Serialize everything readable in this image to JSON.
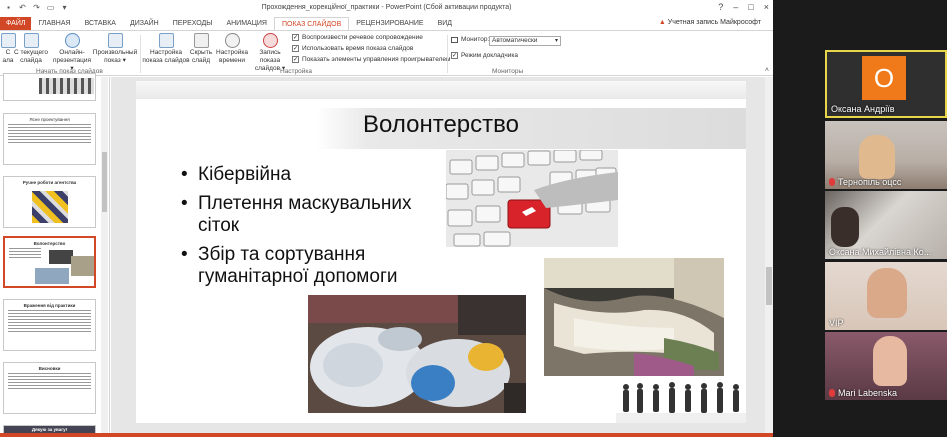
{
  "window": {
    "title": "Прохождення_корекційної_практики - PowerPoint (Сбой активации продукта)",
    "account": "Учетная запись Майкрософт",
    "controls": [
      "?",
      "–",
      "□",
      "×"
    ]
  },
  "tabs": [
    "ФАЙЛ",
    "ГЛАВНАЯ",
    "ВСТАВКА",
    "ДИЗАЙН",
    "ПЕРЕХОДЫ",
    "АНИМАЦИЯ",
    "ПОКАЗ СЛАЙДОВ",
    "РЕЦЕНЗИРОВАНИЕ",
    "ВИД"
  ],
  "active_tab": "ПОКАЗ СЛАЙДОВ",
  "ribbon": {
    "start_group": {
      "buttons": [
        {
          "label1": "С",
          "label2": "ала"
        },
        {
          "label1": "С текущего",
          "label2": "слайда"
        },
        {
          "label1": "Онлайн-",
          "label2": "презентация ▾"
        },
        {
          "label1": "Произвольный",
          "label2": "показ ▾"
        }
      ],
      "label": "Начать показ слайдов"
    },
    "setup_group": {
      "buttons": [
        {
          "label1": "Настройка",
          "label2": "показа слайдов"
        },
        {
          "label1": "Скрыть",
          "label2": "слайд"
        },
        {
          "label1": "Настройка",
          "label2": "времени"
        },
        {
          "label1": "Запись показа",
          "label2": "слайдов ▾"
        }
      ],
      "checks": [
        "Воспроизвести речевое сопровождение",
        "Использовать время показа слайдов",
        "Показать элементы управления проигрывателем"
      ],
      "label": "Настройка"
    },
    "monitors_group": {
      "monitor_label": "Монитор:",
      "monitor_value": "Автоматически",
      "presenter_view": "Режим докладчика",
      "label": "Мониторы"
    }
  },
  "thumbnails": [
    {
      "title": ""
    },
    {
      "title": "Ясне проектування"
    },
    {
      "title": "Ручне роботи агентства"
    },
    {
      "title": "Волонтерство"
    },
    {
      "title": "Враження від практики"
    },
    {
      "title": "Висновки"
    },
    {
      "title": "Дякую за увагу!"
    }
  ],
  "slide": {
    "title": "Волонтерство",
    "bullets": [
      "Кібервійна",
      "Плетення маскувальних сіток",
      "Збір та сортування гуманітарної допомоги"
    ]
  },
  "participants": [
    {
      "name": "Оксана Андріїв",
      "initial": "О",
      "muted": false
    },
    {
      "name": "Тернопіль оцсс",
      "muted": true
    },
    {
      "name": "Оксана Михайлівна Ко...",
      "muted": false
    },
    {
      "name": "VIP",
      "muted": false
    },
    {
      "name": "Mari Labenska",
      "muted": true
    }
  ],
  "colors": {
    "accent": "#d24726",
    "active_speaker": "#e8d64a",
    "avatar": "#f07a1a"
  }
}
